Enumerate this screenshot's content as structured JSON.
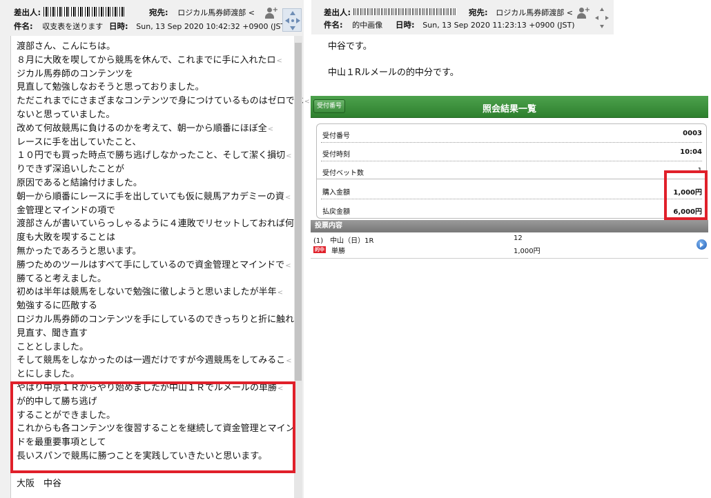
{
  "left_email": {
    "sender_label": "差出人:",
    "to_label": "宛先:",
    "to_value": "ロジカル馬券師渡部 <",
    "subject_label": "件名:",
    "subject_value": "収支表を送ります",
    "date_label": "日時:",
    "date_value": "Sun, 13 Sep 2020 10:42:32 +0900 (JST)",
    "body_lines": [
      {
        "text": "渡部さん、こんにちは。",
        "wrap": false
      },
      {
        "text": "８月に大敗を喫してから競馬を休んで、これまでに手に入れたロ",
        "wrap": true
      },
      {
        "text": "ジカル馬券師のコンテンツを",
        "wrap": false
      },
      {
        "text": "見直して勉強しなおそうと思っておりました。",
        "wrap": false
      },
      {
        "text": "ただこれまでにさまざまなコンテンツで身につけているものはゼロでは",
        "wrap": true
      },
      {
        "text": "ないと思っていました。",
        "wrap": false
      },
      {
        "text": "改めて何故競馬に負けるのかを考えて、朝一から順番にほぼ全",
        "wrap": true
      },
      {
        "text": "レースに手を出していたこと、",
        "wrap": false
      },
      {
        "text": "１０円でも買った時点で勝ち逃げしなかったこと、そして潔く損切",
        "wrap": true
      },
      {
        "text": "りできず深追いしたことが",
        "wrap": false
      },
      {
        "text": "原因であると結論付けました。",
        "wrap": false
      },
      {
        "text": "朝一から順番にレースに手を出していても仮に競馬アカデミーの資",
        "wrap": true
      },
      {
        "text": "金管理とマインドの項で",
        "wrap": false
      },
      {
        "text": "渡部さんが書いていらっしゃるように４連敗でリセットしておれば何",
        "wrap": true
      },
      {
        "text": "度も大敗を喫することは",
        "wrap": false
      },
      {
        "text": "無かったであろうと思います。",
        "wrap": false
      },
      {
        "text": "勝つためのツールはすべて手にしているので資金管理とマインドで",
        "wrap": true
      },
      {
        "text": "勝てると考えました。",
        "wrap": false
      },
      {
        "text": "初めは半年は競馬をしないで勉強に徹しようと思いましたが半年",
        "wrap": true
      },
      {
        "text": "勉強するに匹敵する",
        "wrap": false
      },
      {
        "text": "ロジカル馬券師のコンテンツを手にしているのできっちりと折に触れ",
        "wrap": true
      },
      {
        "text": "見直す、聞き直す",
        "wrap": false
      },
      {
        "text": "こととしました。",
        "wrap": false
      },
      {
        "text": "そして競馬をしなかったのは一週だけですが今週競馬をしてみるこ",
        "wrap": true
      },
      {
        "text": "とにしました。",
        "wrap": false
      },
      {
        "text": "やはり中京１Ｒからやり始めましたが中山１Ｒでルメールの単勝",
        "wrap": true
      },
      {
        "text": "が的中して勝ち逃げ",
        "wrap": false
      },
      {
        "text": "することができました。",
        "wrap": false
      },
      {
        "text": "これからも各コンテンツを復習することを継続して資金管理とマイン",
        "wrap": true
      },
      {
        "text": "ドを最重要事項として",
        "wrap": false
      },
      {
        "text": "長いスパンで競馬に勝つことを実践していきたいと思います。",
        "wrap": false
      },
      {
        "text": "",
        "wrap": false
      },
      {
        "text": "大阪　中谷",
        "wrap": false
      }
    ]
  },
  "right_email": {
    "sender_label": "差出人:",
    "to_label": "宛先:",
    "to_value": "ロジカル馬券師渡部 <",
    "subject_label": "件名:",
    "subject_value": "的中画像",
    "date_label": "日時:",
    "date_value": "Sun, 13 Sep 2020 11:23:13 +0900 (JST)",
    "body_line1": "中谷です。",
    "body_line2": "中山１Rルメールの的中分です。"
  },
  "bet_result": {
    "title": "照会結果一覧",
    "button_label": "受付番号",
    "rows": [
      {
        "label": "受付番号",
        "value": "0003"
      },
      {
        "label": "受付時刻",
        "value": "10:04"
      },
      {
        "label": "受付ベット数",
        "value": "1"
      },
      {
        "label": "購入金額",
        "value": "1,000円"
      },
      {
        "label": "払戻金額",
        "value": "6,000円"
      }
    ],
    "content_header": "投票内容",
    "race": "(1)　中山（日）1R",
    "bet_type": "単勝",
    "horse_number": "12",
    "amount": "1,000円",
    "hit_badge": "的中"
  },
  "colors": {
    "highlight": "#e0202a",
    "green_bar": "#2e7f2e",
    "gray_bar": "#787878"
  }
}
